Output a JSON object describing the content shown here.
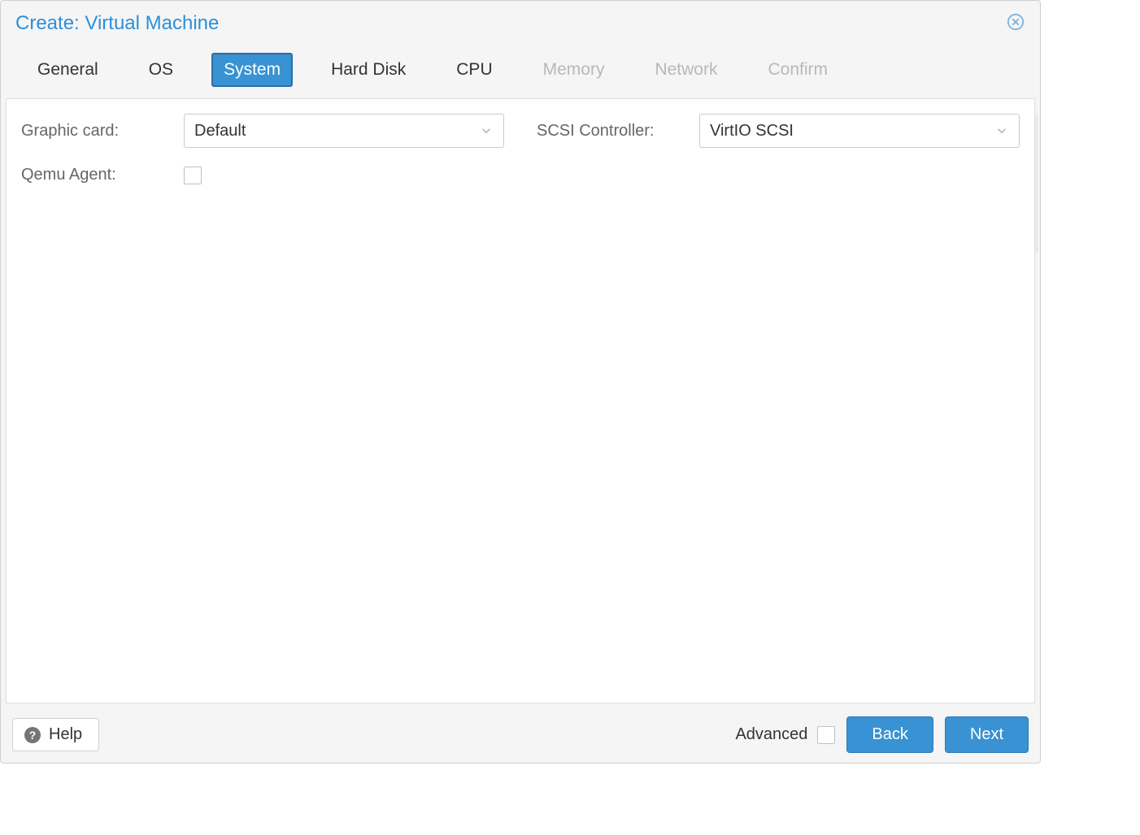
{
  "window": {
    "title": "Create: Virtual Machine"
  },
  "tabs": [
    {
      "label": "General",
      "state": "enabled"
    },
    {
      "label": "OS",
      "state": "enabled"
    },
    {
      "label": "System",
      "state": "active"
    },
    {
      "label": "Hard Disk",
      "state": "enabled"
    },
    {
      "label": "CPU",
      "state": "enabled"
    },
    {
      "label": "Memory",
      "state": "disabled"
    },
    {
      "label": "Network",
      "state": "disabled"
    },
    {
      "label": "Confirm",
      "state": "disabled"
    }
  ],
  "form": {
    "graphic_card": {
      "label": "Graphic card:",
      "value": "Default"
    },
    "scsi_controller": {
      "label": "SCSI Controller:",
      "value": "VirtIO SCSI"
    },
    "qemu_agent": {
      "label": "Qemu Agent:",
      "checked": false
    }
  },
  "footer": {
    "help": "Help",
    "advanced": "Advanced",
    "advanced_checked": false,
    "back": "Back",
    "next": "Next"
  }
}
